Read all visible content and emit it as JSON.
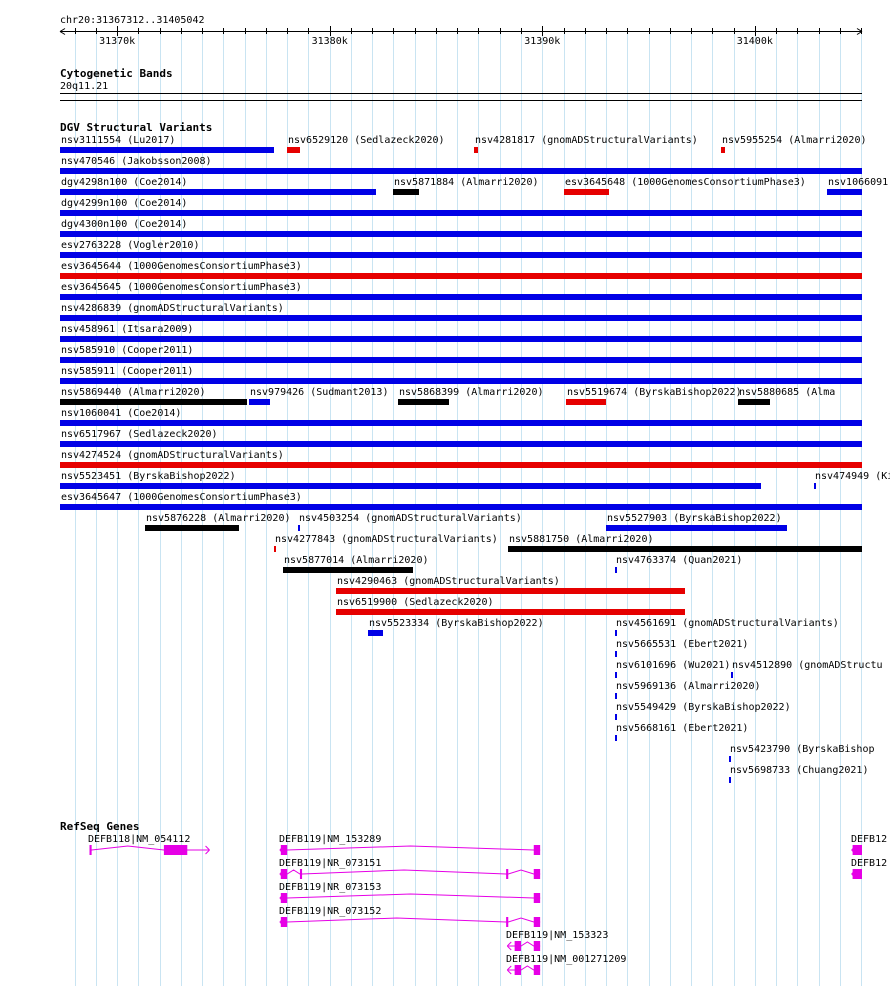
{
  "ruler": {
    "region": "chr20:31367312..31405042",
    "start": 31367312,
    "end": 31405042,
    "ticks": [
      {
        "pos": 31370000,
        "label": "31370k"
      },
      {
        "pos": 31380000,
        "label": "31380k"
      },
      {
        "pos": 31390000,
        "label": "31390k"
      },
      {
        "pos": 31400000,
        "label": "31400k"
      }
    ]
  },
  "colors": {
    "gain": "#0000e6",
    "loss": "#e60000",
    "complex": "#000000",
    "gene": "#e600e6",
    "grid": "#c9e4f2"
  },
  "tracks": {
    "cytobands": {
      "title": "Cytogenetic Bands",
      "band": "20q11.21"
    },
    "dgv": {
      "title": "DGV Structural Variants",
      "features": [
        {
          "label": "nsv3111554 (Lu2017)",
          "color": "gain",
          "start": 31367312,
          "end": 31377400,
          "row": 0
        },
        {
          "label": "nsv6529120 (Sedlazeck2020)",
          "color": "loss",
          "start": 31378000,
          "end": 31378600,
          "row": 0
        },
        {
          "label": "nsv4281817 (gnomADStructuralVariants)",
          "color": "loss",
          "start": 31386800,
          "end": 31387000,
          "row": 0
        },
        {
          "label": "nsv5955254 (Almarri2020)",
          "color": "loss",
          "start": 31398400,
          "end": 31398600,
          "row": 0
        },
        {
          "label": "nsv470546 (Jakobsson2008)",
          "color": "gain",
          "start": 31367312,
          "end": 31405042,
          "row": 1
        },
        {
          "label": "dgv4298n100 (Coe2014)",
          "color": "gain",
          "start": 31367312,
          "end": 31382200,
          "row": 2
        },
        {
          "label": "nsv5871884 (Almarri2020)",
          "color": "complex",
          "start": 31383000,
          "end": 31384200,
          "row": 2
        },
        {
          "label": "esv3645648 (1000GenomesConsortiumPhase3)",
          "color": "loss",
          "start": 31391000,
          "end": 31393100,
          "row": 2
        },
        {
          "label": "nsv1066091",
          "color": "gain",
          "start": 31403400,
          "end": 31405042,
          "row": 2
        },
        {
          "label": "dgv4299n100 (Coe2014)",
          "color": "gain",
          "start": 31367312,
          "end": 31405042,
          "row": 3
        },
        {
          "label": "dgv4300n100 (Coe2014)",
          "color": "gain",
          "start": 31367312,
          "end": 31405042,
          "row": 4
        },
        {
          "label": "esv2763228 (Vogler2010)",
          "color": "gain",
          "start": 31367312,
          "end": 31405042,
          "row": 5
        },
        {
          "label": "esv3645644 (1000GenomesConsortiumPhase3)",
          "color": "loss",
          "start": 31367312,
          "end": 31405042,
          "row": 6
        },
        {
          "label": "esv3645645 (1000GenomesConsortiumPhase3)",
          "color": "gain",
          "start": 31367312,
          "end": 31405042,
          "row": 7
        },
        {
          "label": "nsv4286839 (gnomADStructuralVariants)",
          "color": "gain",
          "start": 31367312,
          "end": 31405042,
          "row": 8
        },
        {
          "label": "nsv458961 (Itsara2009)",
          "color": "gain",
          "start": 31367312,
          "end": 31405042,
          "row": 9
        },
        {
          "label": "nsv585910 (Cooper2011)",
          "color": "gain",
          "start": 31367312,
          "end": 31405042,
          "row": 10
        },
        {
          "label": "nsv585911 (Cooper2011)",
          "color": "gain",
          "start": 31367312,
          "end": 31405042,
          "row": 11
        },
        {
          "label": "nsv5869440 (Almarri2020)",
          "color": "complex",
          "start": 31367312,
          "end": 31376100,
          "row": 12
        },
        {
          "label": "nsv979426 (Sudmant2013)",
          "color": "gain",
          "start": 31376200,
          "end": 31377200,
          "row": 12
        },
        {
          "label": "nsv5868399 (Almarri2020)",
          "color": "complex",
          "start": 31383200,
          "end": 31385600,
          "row": 12
        },
        {
          "label": "nsv5519674 (ByrskaBishop2022)",
          "color": "loss",
          "start": 31391100,
          "end": 31393000,
          "row": 12
        },
        {
          "label": "nsv5880685 (Alma",
          "color": "complex",
          "start": 31399200,
          "end": 31400700,
          "row": 12
        },
        {
          "label": "nsv1060041 (Coe2014)",
          "color": "gain",
          "start": 31367312,
          "end": 31405042,
          "row": 13
        },
        {
          "label": "nsv6517967 (Sedlazeck2020)",
          "color": "gain",
          "start": 31367312,
          "end": 31405042,
          "row": 14
        },
        {
          "label": "nsv4274524 (gnomADStructuralVariants)",
          "color": "loss",
          "start": 31367312,
          "end": 31405042,
          "row": 15
        },
        {
          "label": "nsv5523451 (ByrskaBishop2022)",
          "color": "gain",
          "start": 31367312,
          "end": 31400300,
          "row": 16
        },
        {
          "label": "nsv474949 (Ki",
          "color": "gain",
          "start": 31402800,
          "end": 31402900,
          "row": 16
        },
        {
          "label": "esv3645647 (1000GenomesConsortiumPhase3)",
          "color": "gain",
          "start": 31367312,
          "end": 31405042,
          "row": 17
        },
        {
          "label": "nsv5876228 (Almarri2020)",
          "color": "complex",
          "start": 31371300,
          "end": 31375700,
          "row": 18
        },
        {
          "label": "nsv4503254 (gnomADStructuralVariants)",
          "color": "gain",
          "start": 31378500,
          "end": 31378600,
          "row": 18
        },
        {
          "label": "nsv5527903 (ByrskaBishop2022)",
          "color": "gain",
          "start": 31393000,
          "end": 31401500,
          "row": 18
        },
        {
          "label": "nsv4277843 (gnomADStructuralVariants)",
          "color": "loss",
          "start": 31377400,
          "end": 31377500,
          "row": 19
        },
        {
          "label": "nsv5881750 (Almarri2020)",
          "color": "complex",
          "start": 31388400,
          "end": 31405042,
          "row": 19
        },
        {
          "label": "nsv5877014 (Almarri2020)",
          "color": "complex",
          "start": 31377800,
          "end": 31383900,
          "row": 20
        },
        {
          "label": "nsv4763374 (Quan2021)",
          "color": "gain",
          "start": 31393400,
          "end": 31393500,
          "row": 20
        },
        {
          "label": "nsv4290463 (gnomADStructuralVariants)",
          "color": "loss",
          "start": 31380300,
          "end": 31396700,
          "row": 21
        },
        {
          "label": "nsv6519900 (Sedlazeck2020)",
          "color": "loss",
          "start": 31380300,
          "end": 31396700,
          "row": 22
        },
        {
          "label": "nsv5523334 (ByrskaBishop2022)",
          "color": "gain",
          "start": 31381800,
          "end": 31382500,
          "row": 23
        },
        {
          "label": "nsv4561691 (gnomADStructuralVariants)",
          "color": "gain",
          "start": 31393400,
          "end": 31393500,
          "row": 23
        },
        {
          "label": "nsv5665531 (Ebert2021)",
          "color": "gain",
          "start": 31393400,
          "end": 31393500,
          "row": 24
        },
        {
          "label": "nsv6101696 (Wu2021)",
          "color": "gain",
          "start": 31393400,
          "end": 31393500,
          "row": 25
        },
        {
          "label": "nsv4512890 (gnomADStructu",
          "color": "gain",
          "start": 31398900,
          "end": 31399000,
          "row": 25
        },
        {
          "label": "nsv5969136 (Almarri2020)",
          "color": "gain",
          "start": 31393400,
          "end": 31393500,
          "row": 26
        },
        {
          "label": "nsv5549429 (ByrskaBishop2022)",
          "color": "gain",
          "start": 31393400,
          "end": 31393500,
          "row": 27
        },
        {
          "label": "nsv5668161 (Ebert2021)",
          "color": "gain",
          "start": 31393400,
          "end": 31393500,
          "row": 28
        },
        {
          "label": "nsv5423790 (ByrskaBishop",
          "color": "gain",
          "start": 31398800,
          "end": 31398900,
          "row": 29
        },
        {
          "label": "nsv5698733 (Chuang2021)",
          "color": "gain",
          "start": 31398800,
          "end": 31398900,
          "row": 30
        }
      ]
    },
    "refseq": {
      "title": "RefSeq Genes",
      "genes": [
        {
          "label": "DEFB118|NM_054112",
          "row": 0,
          "strand": "+",
          "start": 31368700,
          "end": 31374300,
          "exons": [
            [
              31368700,
              31368800
            ],
            [
              31372200,
              31373300
            ]
          ]
        },
        {
          "label": "DEFB119|NM_153289",
          "row": 0,
          "strand": "-",
          "start": 31377700,
          "end": 31389900,
          "exons": [
            [
              31377700,
              31378000
            ],
            [
              31389600,
              31389900
            ]
          ]
        },
        {
          "label": "DEFB12",
          "row": 0,
          "strand": "-",
          "start": 31404600,
          "end": 31405042,
          "exons": [
            [
              31404600,
              31405042
            ]
          ]
        },
        {
          "label": "DEFB119|NR_073151",
          "row": 1,
          "strand": "-",
          "start": 31377700,
          "end": 31389900,
          "exons": [
            [
              31377700,
              31378000
            ],
            [
              31378600,
              31378700
            ],
            [
              31388300,
              31388400
            ],
            [
              31389600,
              31389900
            ]
          ]
        },
        {
          "label": "DEFB12",
          "row": 1,
          "strand": "-",
          "start": 31404600,
          "end": 31405042,
          "exons": [
            [
              31404600,
              31405042
            ]
          ]
        },
        {
          "label": "DEFB119|NR_073153",
          "row": 2,
          "strand": "-",
          "start": 31377700,
          "end": 31389900,
          "exons": [
            [
              31377700,
              31378000
            ],
            [
              31389600,
              31389900
            ]
          ]
        },
        {
          "label": "DEFB119|NR_073152",
          "row": 3,
          "strand": "-",
          "start": 31377700,
          "end": 31389900,
          "exons": [
            [
              31377700,
              31378000
            ],
            [
              31388300,
              31388400
            ],
            [
              31389600,
              31389900
            ]
          ]
        },
        {
          "label": "DEFB119|NM_153323",
          "row": 4,
          "strand": "-",
          "start": 31388400,
          "end": 31389900,
          "exons": [
            [
              31388700,
              31389000
            ],
            [
              31389600,
              31389900
            ]
          ]
        },
        {
          "label": "DEFB119|NM_001271209",
          "row": 5,
          "strand": "-",
          "start": 31388400,
          "end": 31389900,
          "exons": [
            [
              31388700,
              31389000
            ],
            [
              31389600,
              31389900
            ]
          ]
        }
      ]
    }
  }
}
